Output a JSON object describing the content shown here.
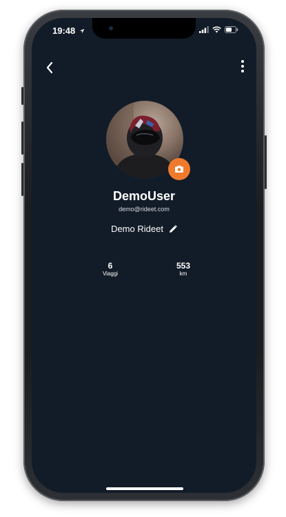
{
  "status_bar": {
    "time": "19:48",
    "location_icon": "location-arrow-icon",
    "signal_icon": "cellular-signal-icon",
    "wifi_icon": "wifi-icon",
    "battery_icon": "battery-icon"
  },
  "nav": {
    "back_icon": "chevron-left-icon",
    "more_icon": "more-vertical-icon"
  },
  "profile": {
    "username": "DemoUser",
    "email": "demo@rideet.com",
    "full_name": "Demo Rideet",
    "edit_icon": "pencil-icon",
    "camera_icon": "camera-icon"
  },
  "stats": [
    {
      "value": "6",
      "label": "Viaggi"
    },
    {
      "value": "553",
      "label": "km"
    }
  ],
  "colors": {
    "background": "#121c28",
    "accent": "#f07a2c",
    "text": "#ffffff"
  }
}
